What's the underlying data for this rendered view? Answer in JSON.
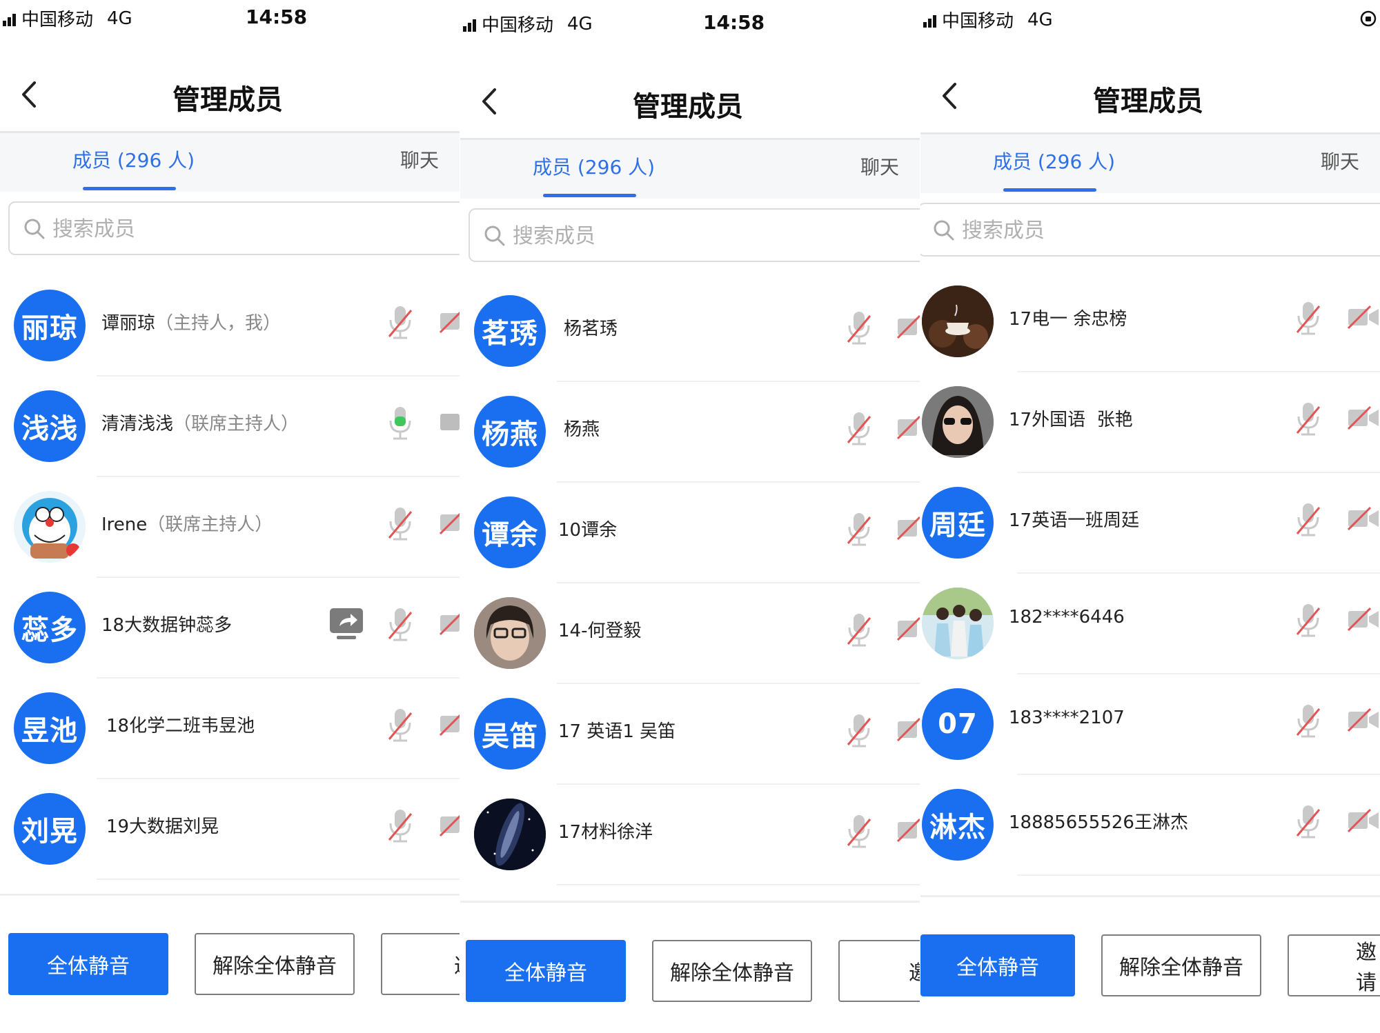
{
  "colors": {
    "accent": "#2f70e8",
    "avatar_blue": "#1a6ff0",
    "muted_red": "#e05555",
    "mic_active_green": "#3fc75b"
  },
  "panels": [
    {
      "status": {
        "carrier": "中国移动",
        "network": "4G",
        "time": "14:58"
      },
      "title": "管理成员",
      "tabs": {
        "members": "成员 (296 人)",
        "chat": "聊天"
      },
      "search": {
        "placeholder": "搜索成员"
      },
      "members": [
        {
          "avatar_text": "丽琼",
          "name": "谭丽琼",
          "role": "（主持人，我）",
          "mic": "muted",
          "cam": "off",
          "share": false
        },
        {
          "avatar_text": "浅浅",
          "name": "清清浅浅",
          "role": "（联席主持人）",
          "mic": "active",
          "cam": "on",
          "share": false
        },
        {
          "avatar_text": "",
          "avatar_photo": "cartoon-avatar",
          "name": "Irene",
          "role": "（联席主持人）",
          "mic": "muted",
          "cam": "off",
          "share": false
        },
        {
          "avatar_text": "蕊多",
          "name": "18大数据钟蕊多",
          "role": "",
          "mic": "muted",
          "cam": "off",
          "share": true
        },
        {
          "avatar_text": "昱池",
          "name": "18化学二班韦昱池",
          "role": "",
          "mic": "muted",
          "cam": "off",
          "share": false
        },
        {
          "avatar_text": "刘晃",
          "name": "19大数据刘晃",
          "role": "",
          "mic": "muted",
          "cam": "off",
          "share": false
        }
      ],
      "footer": {
        "mute_all": "全体静音",
        "unmute_all": "解除全体静音",
        "invite": "邀"
      }
    },
    {
      "status": {
        "carrier": "中国移动",
        "network": "4G",
        "time": "14:58"
      },
      "title": "管理成员",
      "tabs": {
        "members": "成员 (296 人)",
        "chat": "聊天"
      },
      "search": {
        "placeholder": "搜索成员"
      },
      "members": [
        {
          "avatar_text": "茗琇",
          "name": "杨茗琇",
          "role": "",
          "mic": "muted",
          "cam": "off",
          "share": false
        },
        {
          "avatar_text": "杨燕",
          "name": "杨燕",
          "role": "",
          "mic": "muted",
          "cam": "off",
          "share": false
        },
        {
          "avatar_text": "谭余",
          "name": "10谭余",
          "role": "",
          "mic": "muted",
          "cam": "off",
          "share": false
        },
        {
          "avatar_text": "",
          "avatar_photo": "person-photo",
          "name": "14-何登毅",
          "role": "",
          "mic": "muted",
          "cam": "off",
          "share": false
        },
        {
          "avatar_text": "吴笛",
          "name": "17 英语1 吴笛",
          "role": "",
          "mic": "muted",
          "cam": "off",
          "share": false
        },
        {
          "avatar_text": "",
          "avatar_photo": "galaxy-photo",
          "name": "17材料徐洋",
          "role": "",
          "mic": "muted",
          "cam": "off",
          "share": false
        }
      ],
      "footer": {
        "mute_all": "全体静音",
        "unmute_all": "解除全体静音",
        "invite": "邀"
      }
    },
    {
      "status": {
        "carrier": "中国移动",
        "network": "4G",
        "time": ""
      },
      "title": "管理成员",
      "tabs": {
        "members": "成员 (296 人)",
        "chat": "聊天"
      },
      "search": {
        "placeholder": "搜索成员"
      },
      "members": [
        {
          "avatar_text": "",
          "avatar_photo": "coffee-photo",
          "name": "17电一 余忠榜",
          "role": "",
          "mic": "muted",
          "cam": "off",
          "share": false
        },
        {
          "avatar_text": "",
          "avatar_photo": "person-photo",
          "name": "17外国语  张艳",
          "role": "",
          "mic": "muted",
          "cam": "off",
          "share": false
        },
        {
          "avatar_text": "周廷",
          "name": "17英语一班周廷",
          "role": "",
          "mic": "muted",
          "cam": "off",
          "share": false
        },
        {
          "avatar_text": "",
          "avatar_photo": "group-photo",
          "name": "182****6446",
          "role": "",
          "mic": "muted",
          "cam": "off",
          "share": false
        },
        {
          "avatar_text": "07",
          "name": "183****2107",
          "role": "",
          "mic": "muted",
          "cam": "off",
          "share": false
        },
        {
          "avatar_text": "淋杰",
          "name": "18885655526王淋杰",
          "role": "",
          "mic": "muted",
          "cam": "off",
          "share": false
        }
      ],
      "footer": {
        "mute_all": "全体静音",
        "unmute_all": "解除全体静音",
        "invite": "邀请"
      }
    }
  ]
}
